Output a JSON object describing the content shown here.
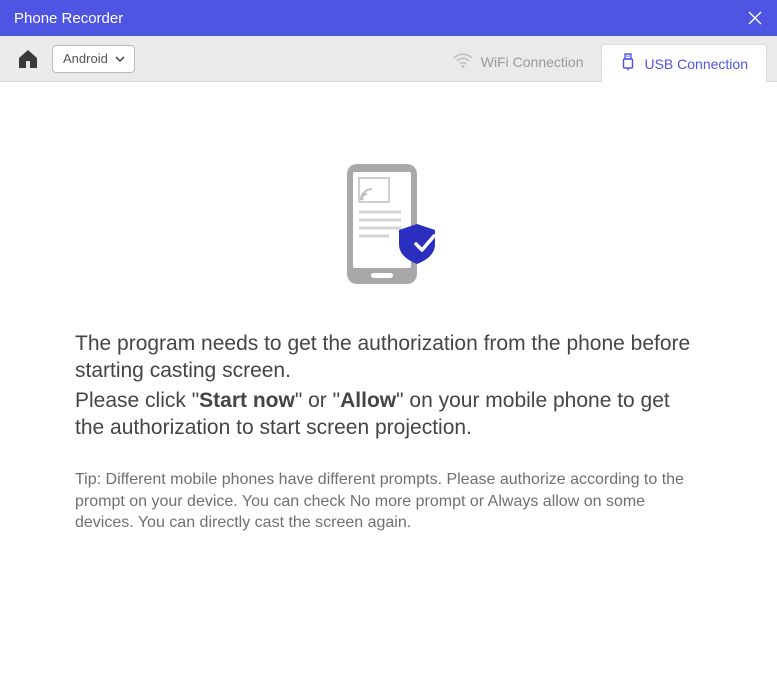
{
  "title": "Phone Recorder",
  "toolbar": {
    "platform_label": "Android"
  },
  "tabs": {
    "wifi_label": "WiFi Connection",
    "usb_label": "USB Connection"
  },
  "message": {
    "line1": "The program needs to get the authorization from the phone before starting casting screen.",
    "action_prefix": "Please click \"",
    "action_bold1": "Start now",
    "action_mid": "\" or \"",
    "action_bold2": "Allow",
    "action_suffix": "\" on your mobile phone to get the authorization to start screen projection."
  },
  "tip": "Tip: Different mobile phones have different prompts. Please authorize according to the prompt on your device. You can check No more prompt or Always allow on some devices. You can directly cast the screen again.",
  "colors": {
    "accent": "#4e55e2",
    "shield": "#2a2fbf"
  }
}
